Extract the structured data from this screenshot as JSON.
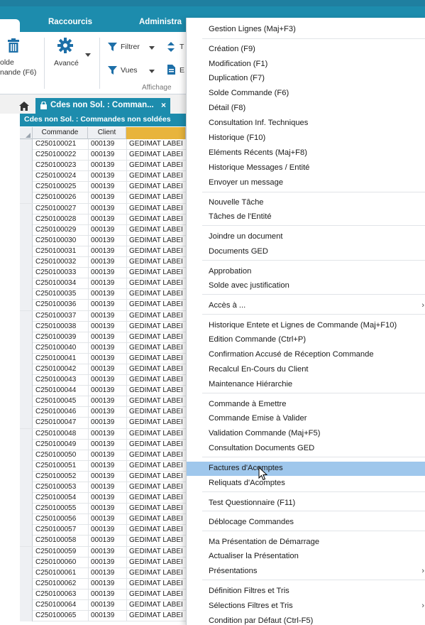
{
  "ribbon": {
    "tabs": [
      "Raccourcis",
      "Administra"
    ],
    "left_btn_line1": "olde",
    "left_btn_line2": "nande (F6)",
    "avance_label": "Avancé",
    "filtrer_label": "Filtrer",
    "vues_label": "Vues",
    "t_label": "T",
    "e_label": "E",
    "group_label": "Affichage"
  },
  "doc_tab": {
    "title": "Cdes non Sol. : Comman...",
    "close": "×"
  },
  "grid": {
    "title": "Cdes non Sol. : Commandes non soldées",
    "columns": [
      "Commande",
      "Client",
      ""
    ],
    "client": "000139",
    "name": "GEDIMAT LABEI",
    "commandes": [
      "C250100021",
      "C250100022",
      "C250100023",
      "C250100024",
      "C250100025",
      "C250100026",
      "C250100027",
      "C250100028",
      "C250100029",
      "C250100030",
      "C250100031",
      "C250100032",
      "C250100033",
      "C250100034",
      "C250100035",
      "C250100036",
      "C250100037",
      "C250100038",
      "C250100039",
      "C250100040",
      "C250100041",
      "C250100042",
      "C250100043",
      "C250100044",
      "C250100045",
      "C250100046",
      "C250100047",
      "C250100048",
      "C250100049",
      "C250100050",
      "C250100051",
      "C250100052",
      "C250100053",
      "C250100054",
      "C250100055",
      "C250100056",
      "C250100057",
      "C250100058",
      "C250100059",
      "C250100060",
      "C250100061",
      "C250100062",
      "C250100063",
      "C250100064",
      "C250100065"
    ]
  },
  "menu": {
    "items": [
      {
        "label": "Gestion Lignes (Maj+F3)"
      },
      {
        "label": "Création (F9)"
      },
      {
        "label": "Modification (F1)"
      },
      {
        "label": "Duplication (F7)"
      },
      {
        "label": "Solde Commande (F6)"
      },
      {
        "label": "Détail (F8)"
      },
      {
        "label": "Consultation Inf. Techniques"
      },
      {
        "label": "Historique (F10)"
      },
      {
        "label": "Eléments Récents (Maj+F8)"
      },
      {
        "label": "Historique Messages / Entité"
      },
      {
        "label": "Envoyer un message"
      },
      {
        "label": "Nouvelle Tâche"
      },
      {
        "label": "Tâches de l'Entité"
      },
      {
        "label": "Joindre un document"
      },
      {
        "label": "Documents GED"
      },
      {
        "label": "Approbation"
      },
      {
        "label": "Solde avec justification"
      },
      {
        "label": "Accès à ...",
        "submenu": true
      },
      {
        "label": "Historique Entete et Lignes de Commande (Maj+F10)"
      },
      {
        "label": "Edition Commande (Ctrl+P)"
      },
      {
        "label": "Confirmation Accusé de Réception Commande"
      },
      {
        "label": "Recalcul En-Cours du Client"
      },
      {
        "label": "Maintenance Hiérarchie"
      },
      {
        "label": "Commande à Emettre"
      },
      {
        "label": "Commande Emise à Valider"
      },
      {
        "label": "Validation Commande (Maj+F5)"
      },
      {
        "label": "Consultation Documents GED"
      },
      {
        "label": "Factures d'Acomptes",
        "highlighted": true
      },
      {
        "label": "Reliquats d'Acomptes"
      },
      {
        "label": "Test Questionnaire (F11)"
      },
      {
        "label": "Déblocage Commandes"
      },
      {
        "label": "Ma Présentation de Démarrage"
      },
      {
        "label": "Actualiser la Présentation"
      },
      {
        "label": "Présentations",
        "submenu": true
      },
      {
        "label": "Définition Filtres et Tris"
      },
      {
        "label": "Sélections Filtres et Tris",
        "submenu": true
      },
      {
        "label": "Condition par Défaut (Ctrl-F5)"
      }
    ]
  },
  "colors": {
    "accent": "#1d8cad",
    "highlight": "#9fc7ec",
    "selected_column": "#e8b43c",
    "icon_blue": "#1d6fa8"
  }
}
